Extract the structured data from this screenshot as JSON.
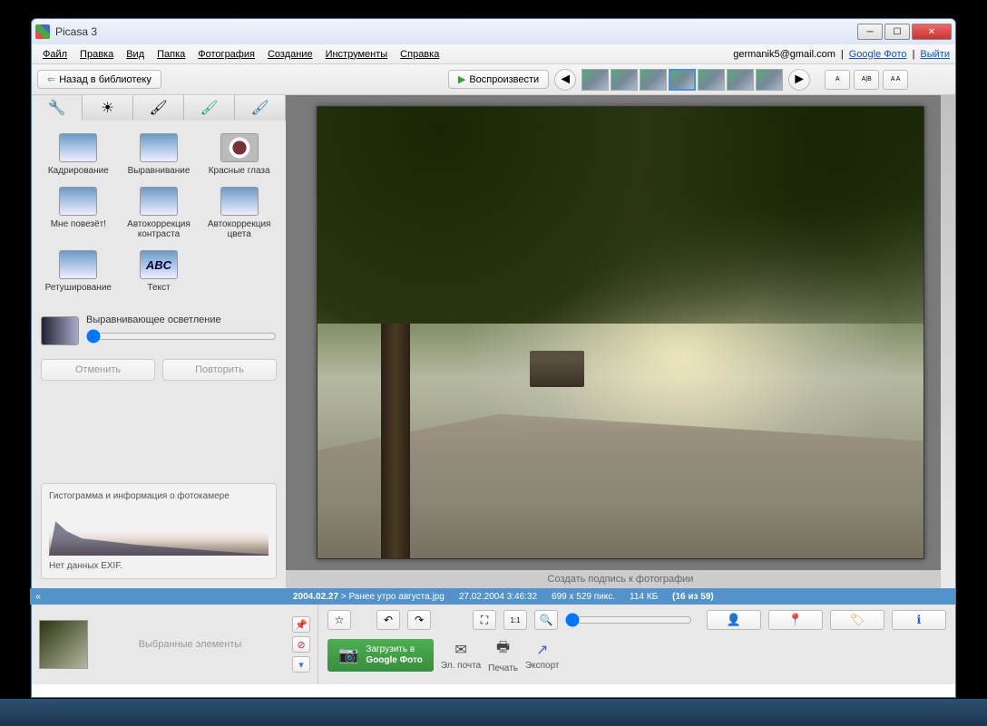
{
  "window": {
    "title": "Picasa 3"
  },
  "menu": {
    "items": [
      "Файл",
      "Правка",
      "Вид",
      "Папка",
      "Фотография",
      "Создание",
      "Инструменты",
      "Справка"
    ],
    "user_email": "germanik5@gmail.com",
    "google_photos_link": "Google Фото",
    "logout": "Выйти",
    "separator": "|"
  },
  "toolbar": {
    "back_label": "Назад в библиотеку",
    "play_label": "Воспроизвести",
    "view_modes": [
      "A",
      "A|B",
      "A A"
    ]
  },
  "tools": {
    "items": [
      "Кадрирование",
      "Выравнивание",
      "Красные глаза",
      "Мне повезёт!",
      "Автокоррекция контраста",
      "Автокоррекция цвета",
      "Ретуширование",
      "Текст"
    ],
    "abc_text": "ABC",
    "fill_light_label": "Выравнивающее осветление",
    "undo": "Отменить",
    "redo": "Повторить"
  },
  "histogram": {
    "title": "Гистограмма и информация о фотокамере",
    "exif": "Нет данных EXIF."
  },
  "caption": {
    "placeholder": "Создать подпись к фотографии"
  },
  "status": {
    "folder": "2004.02.27",
    "sep": ">",
    "filename": "Ранее утро августа.jpg",
    "datetime": "27.02.2004 3:46:32",
    "dimensions": "699 x 529",
    "dim_unit": "пикс.",
    "filesize": "114 КБ",
    "position": "(16 из 59)"
  },
  "selection": {
    "label": "Выбранные элементы"
  },
  "bottom_actions": {
    "google_line1": "Загрузить в",
    "google_line2": "Google Фото",
    "email": "Эл. почта",
    "print": "Печать",
    "export": "Экспорт"
  }
}
